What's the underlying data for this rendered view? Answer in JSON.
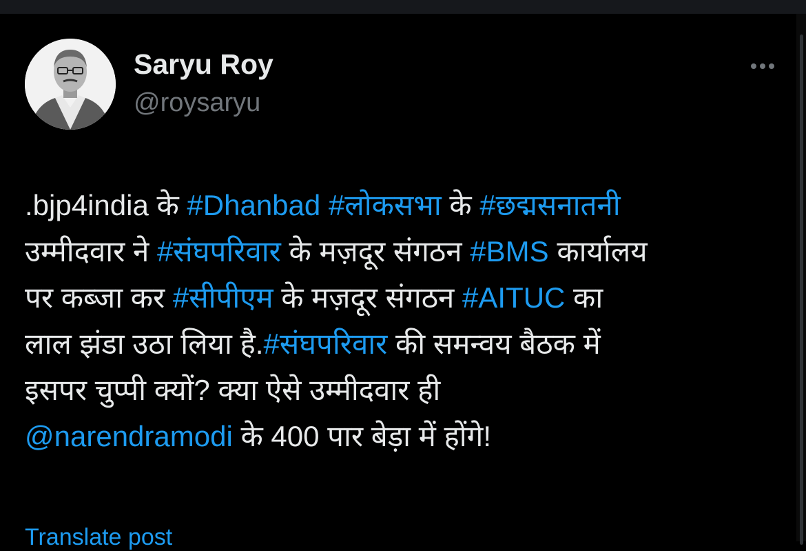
{
  "author": {
    "display_name": "Saryu Roy",
    "handle": "@roysaryu"
  },
  "tweet": {
    "lines": [
      [
        {
          "text": ".bjp4india के ",
          "link": false
        },
        {
          "text": "#Dhanbad",
          "link": true
        },
        {
          "text": " ",
          "link": false
        },
        {
          "text": "#लोकसभा",
          "link": true
        },
        {
          "text": " के ",
          "link": false
        },
        {
          "text": "#छद्मसनातनी",
          "link": true
        }
      ],
      [
        {
          "text": "उम्मीदवार ने ",
          "link": false
        },
        {
          "text": "#संघपरिवार",
          "link": true
        },
        {
          "text": " के मज़दूर संगठन ",
          "link": false
        },
        {
          "text": "#BMS",
          "link": true
        },
        {
          "text": " कार्यालय",
          "link": false
        }
      ],
      [
        {
          "text": "पर कब्जा कर ",
          "link": false
        },
        {
          "text": "#सीपीएम",
          "link": true
        },
        {
          "text": " के मज़दूर संगठन ",
          "link": false
        },
        {
          "text": "#AITUC",
          "link": true
        },
        {
          "text": " का",
          "link": false
        }
      ],
      [
        {
          "text": "लाल झंडा उठा लिया है.",
          "link": false
        },
        {
          "text": "#संघपरिवार",
          "link": true
        },
        {
          "text": " की समन्वय बैठक में",
          "link": false
        }
      ],
      [
        {
          "text": "इसपर चुप्पी क्यों? क्या ऐसे उम्मीदवार ही",
          "link": false
        }
      ],
      [
        {
          "text": "@narendramodi",
          "link": true
        },
        {
          "text": " के 400 पार बेड़ा में होंगे!",
          "link": false
        }
      ]
    ]
  },
  "translate_label": "Translate post",
  "colors": {
    "background": "#000000",
    "text": "#E7E9EA",
    "secondary": "#71767B",
    "link": "#1D9BF0"
  },
  "icons": {
    "more": "more-horizontal-icon"
  }
}
